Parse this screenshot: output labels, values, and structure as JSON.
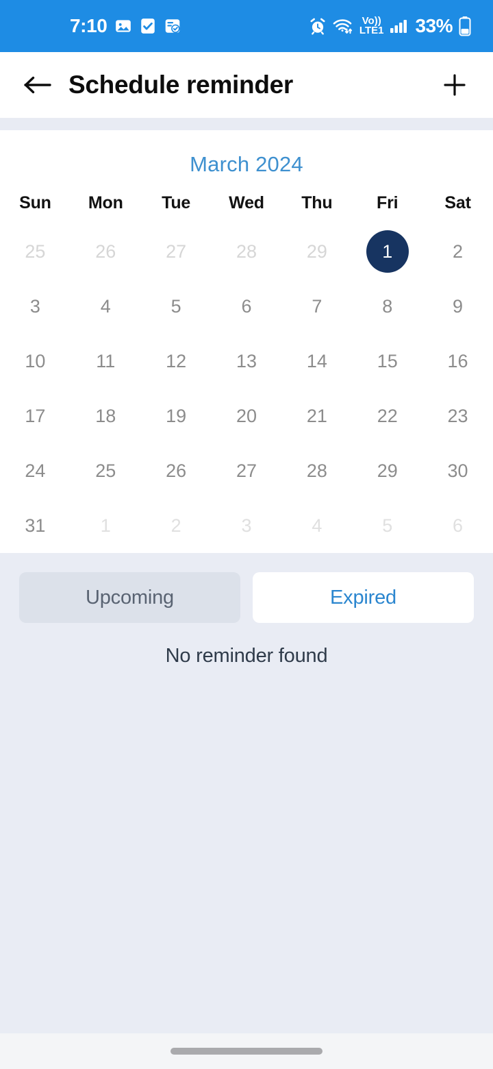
{
  "status_bar": {
    "time": "7:10",
    "battery_percent": "33%",
    "network_label": "VoLTE1",
    "network_top": "Vo))",
    "network_bottom": "LTE1",
    "background_color": "#1e8ce4",
    "left_icons": [
      "image-icon",
      "checkbox-icon",
      "note-check-icon"
    ],
    "right_icons": [
      "alarm-icon",
      "wifi-icon",
      "volte-icon",
      "signal-icon",
      "battery-icon"
    ]
  },
  "app_bar": {
    "back_label": "Back",
    "title": "Schedule reminder",
    "add_label": "Add"
  },
  "calendar": {
    "month_label": "March 2024",
    "month_color": "#3e90cf",
    "selected_color": "#173461",
    "weekdays": [
      "Sun",
      "Mon",
      "Tue",
      "Wed",
      "Thu",
      "Fri",
      "Sat"
    ],
    "weeks": [
      [
        {
          "day": "25",
          "state": "outside"
        },
        {
          "day": "26",
          "state": "outside"
        },
        {
          "day": "27",
          "state": "outside"
        },
        {
          "day": "28",
          "state": "outside"
        },
        {
          "day": "29",
          "state": "outside"
        },
        {
          "day": "1",
          "state": "selected"
        },
        {
          "day": "2",
          "state": "current"
        }
      ],
      [
        {
          "day": "3",
          "state": "current"
        },
        {
          "day": "4",
          "state": "current"
        },
        {
          "day": "5",
          "state": "current"
        },
        {
          "day": "6",
          "state": "current"
        },
        {
          "day": "7",
          "state": "current"
        },
        {
          "day": "8",
          "state": "current"
        },
        {
          "day": "9",
          "state": "current"
        }
      ],
      [
        {
          "day": "10",
          "state": "current"
        },
        {
          "day": "11",
          "state": "current"
        },
        {
          "day": "12",
          "state": "current"
        },
        {
          "day": "13",
          "state": "current"
        },
        {
          "day": "14",
          "state": "current"
        },
        {
          "day": "15",
          "state": "current"
        },
        {
          "day": "16",
          "state": "current"
        }
      ],
      [
        {
          "day": "17",
          "state": "current"
        },
        {
          "day": "18",
          "state": "current"
        },
        {
          "day": "19",
          "state": "current"
        },
        {
          "day": "20",
          "state": "current"
        },
        {
          "day": "21",
          "state": "current"
        },
        {
          "day": "22",
          "state": "current"
        },
        {
          "day": "23",
          "state": "current"
        }
      ],
      [
        {
          "day": "24",
          "state": "current"
        },
        {
          "day": "25",
          "state": "current"
        },
        {
          "day": "26",
          "state": "current"
        },
        {
          "day": "27",
          "state": "current"
        },
        {
          "day": "28",
          "state": "current"
        },
        {
          "day": "29",
          "state": "current"
        },
        {
          "day": "30",
          "state": "current"
        }
      ],
      [
        {
          "day": "31",
          "state": "current"
        },
        {
          "day": "1",
          "state": "outside-soft"
        },
        {
          "day": "2",
          "state": "outside-soft"
        },
        {
          "day": "3",
          "state": "outside-soft"
        },
        {
          "day": "4",
          "state": "outside-soft"
        },
        {
          "day": "5",
          "state": "outside-soft"
        },
        {
          "day": "6",
          "state": "outside-soft"
        }
      ]
    ]
  },
  "reminder_panel": {
    "tabs": [
      {
        "label": "Upcoming",
        "active": false
      },
      {
        "label": "Expired",
        "active": true
      }
    ],
    "empty_message": "No reminder found",
    "active_tab_color": "#2b86cf"
  },
  "navigation_bar": {
    "gesture_pill": "home-gesture-pill"
  }
}
